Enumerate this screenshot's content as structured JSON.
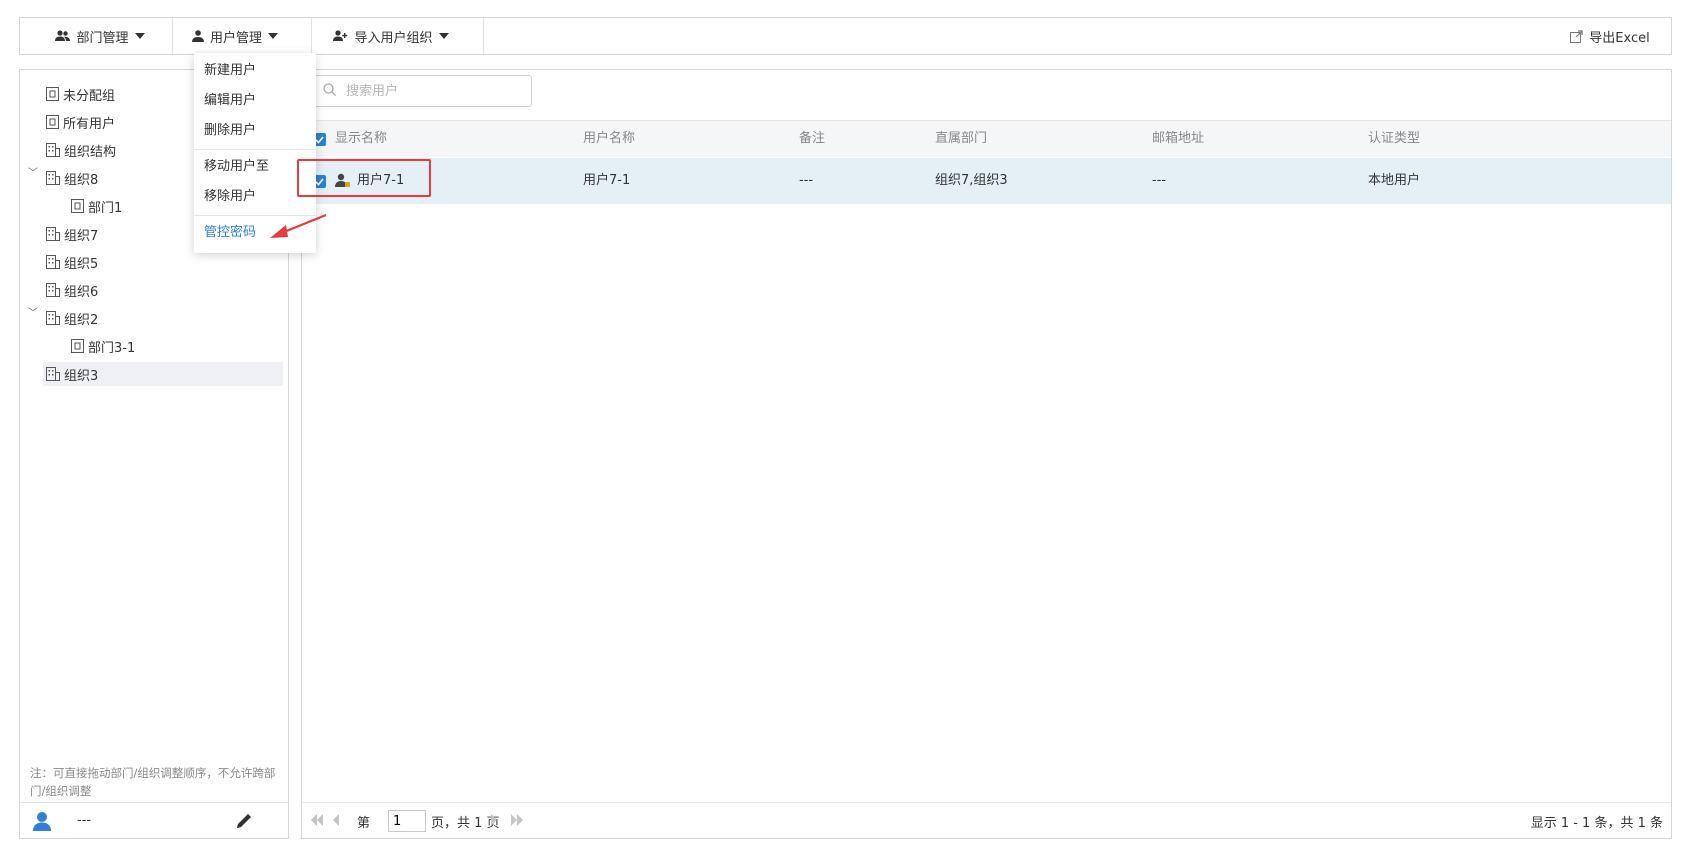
{
  "toolbar": {
    "dept_manage": "部门管理",
    "user_manage": "用户管理",
    "import_user_org": "导入用户组织",
    "export_excel": "导出Excel"
  },
  "user_menu": {
    "items": [
      "新建用户",
      "编辑用户",
      "删除用户",
      "移动用户至",
      "移除用户",
      "管控密码"
    ],
    "active": "管控密码"
  },
  "tree": {
    "items": [
      {
        "label": "未分配组",
        "icon": "door-icon"
      },
      {
        "label": "所有用户",
        "icon": "door-icon"
      },
      {
        "label": "组织结构",
        "icon": "building-icon"
      },
      {
        "label": "组织8",
        "icon": "building-icon",
        "expanded": true
      },
      {
        "label": "部门1",
        "icon": "door-icon"
      },
      {
        "label": "组织7",
        "icon": "building-icon"
      },
      {
        "label": "组织5",
        "icon": "building-icon"
      },
      {
        "label": "组织6",
        "icon": "building-icon"
      },
      {
        "label": "组织2",
        "icon": "building-icon",
        "expanded": true
      },
      {
        "label": "部门3-1",
        "icon": "door-icon"
      },
      {
        "label": "组织3",
        "icon": "building-icon",
        "selected": true
      }
    ],
    "note": "注：可直接拖动部门/组织调整顺序，不允许跨部门/组织调整",
    "footer_user": "---"
  },
  "search": {
    "placeholder": "搜索用户"
  },
  "table": {
    "columns": [
      "显示名称",
      "用户名称",
      "备注",
      "直属部门",
      "邮箱地址",
      "认证类型"
    ],
    "rows": [
      {
        "display_name": "用户7-1",
        "username": "用户7-1",
        "remark": "---",
        "department": "组织7,组织3",
        "email": "---",
        "auth_type": "本地用户",
        "checked": true
      }
    ]
  },
  "pager": {
    "page_prefix": "第",
    "page_value": "1",
    "page_suffix": "页，共 1 页",
    "summary": "显示 1 - 1 条，共 1 条"
  },
  "colors": {
    "accent": "#2f7fd8",
    "selected_row": "#e4f0f5",
    "annotation": "#e53b3b"
  }
}
